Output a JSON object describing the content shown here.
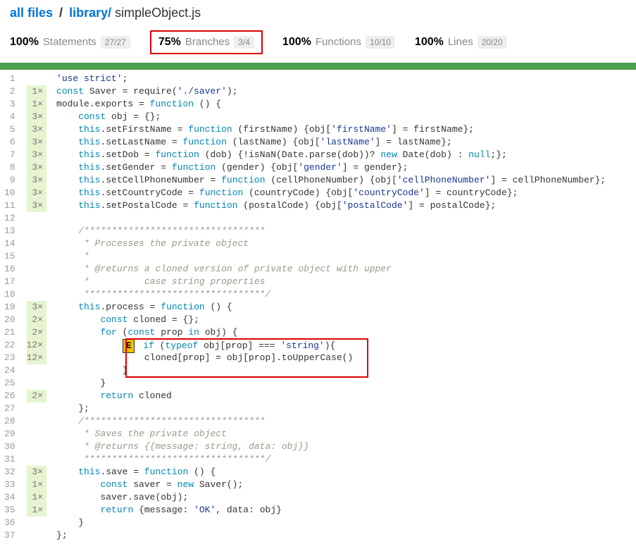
{
  "breadcrumb": {
    "root": "all files",
    "sep1": "/",
    "folder": "library/",
    "file": "simpleObject.js"
  },
  "stats": {
    "statements": {
      "pct": "100%",
      "label": "Statements",
      "fraction": "27/27"
    },
    "branches": {
      "pct": "75%",
      "label": "Branches",
      "fraction": "3/4"
    },
    "functions": {
      "pct": "100%",
      "label": "Functions",
      "fraction": "10/10"
    },
    "lines": {
      "pct": "100%",
      "label": "Lines",
      "fraction": "20/20"
    }
  },
  "lines": [
    {
      "num": 1,
      "hits": "",
      "tokens": [
        {
          "t": "str",
          "v": "'use strict'"
        },
        {
          "t": "",
          "v": ";"
        }
      ]
    },
    {
      "num": 2,
      "hits": "1×",
      "tokens": [
        {
          "t": "kw",
          "v": "const"
        },
        {
          "t": "",
          "v": " Saver = require("
        },
        {
          "t": "str",
          "v": "'./saver'"
        },
        {
          "t": "",
          "v": ");"
        }
      ]
    },
    {
      "num": 3,
      "hits": "1×",
      "tokens": [
        {
          "t": "",
          "v": "module.exports = "
        },
        {
          "t": "kw",
          "v": "function"
        },
        {
          "t": "",
          "v": " () {"
        }
      ]
    },
    {
      "num": 4,
      "hits": "3×",
      "tokens": [
        {
          "t": "",
          "v": "    "
        },
        {
          "t": "kw",
          "v": "const"
        },
        {
          "t": "",
          "v": " obj = {};"
        }
      ]
    },
    {
      "num": 5,
      "hits": "3×",
      "tokens": [
        {
          "t": "",
          "v": "    "
        },
        {
          "t": "kw",
          "v": "this"
        },
        {
          "t": "",
          "v": ".setFirstName = "
        },
        {
          "t": "kw",
          "v": "function"
        },
        {
          "t": "",
          "v": " (firstName) {obj["
        },
        {
          "t": "str",
          "v": "'firstName'"
        },
        {
          "t": "",
          "v": "] = firstName};"
        }
      ]
    },
    {
      "num": 6,
      "hits": "3×",
      "tokens": [
        {
          "t": "",
          "v": "    "
        },
        {
          "t": "kw",
          "v": "this"
        },
        {
          "t": "",
          "v": ".setLastName = "
        },
        {
          "t": "kw",
          "v": "function"
        },
        {
          "t": "",
          "v": " (lastName) {obj["
        },
        {
          "t": "str",
          "v": "'lastName'"
        },
        {
          "t": "",
          "v": "] = lastName};"
        }
      ]
    },
    {
      "num": 7,
      "hits": "3×",
      "tokens": [
        {
          "t": "",
          "v": "    "
        },
        {
          "t": "kw",
          "v": "this"
        },
        {
          "t": "",
          "v": ".setDob = "
        },
        {
          "t": "kw",
          "v": "function"
        },
        {
          "t": "",
          "v": " (dob) {!isNaN(Date.parse(dob))? "
        },
        {
          "t": "kw",
          "v": "new"
        },
        {
          "t": "",
          "v": " Date(dob) : "
        },
        {
          "t": "kw",
          "v": "null"
        },
        {
          "t": "",
          "v": ";};"
        }
      ]
    },
    {
      "num": 8,
      "hits": "3×",
      "tokens": [
        {
          "t": "",
          "v": "    "
        },
        {
          "t": "kw",
          "v": "this"
        },
        {
          "t": "",
          "v": ".setGender = "
        },
        {
          "t": "kw",
          "v": "function"
        },
        {
          "t": "",
          "v": " (gender) {obj["
        },
        {
          "t": "str",
          "v": "'gender'"
        },
        {
          "t": "",
          "v": "] = gender};"
        }
      ]
    },
    {
      "num": 9,
      "hits": "3×",
      "tokens": [
        {
          "t": "",
          "v": "    "
        },
        {
          "t": "kw",
          "v": "this"
        },
        {
          "t": "",
          "v": ".setCellPhoneNumber = "
        },
        {
          "t": "kw",
          "v": "function"
        },
        {
          "t": "",
          "v": " (cellPhoneNumber) {obj["
        },
        {
          "t": "str",
          "v": "'cellPhoneNumber'"
        },
        {
          "t": "",
          "v": "] = cellPhoneNumber};"
        }
      ]
    },
    {
      "num": 10,
      "hits": "3×",
      "tokens": [
        {
          "t": "",
          "v": "    "
        },
        {
          "t": "kw",
          "v": "this"
        },
        {
          "t": "",
          "v": ".setCountryCode = "
        },
        {
          "t": "kw",
          "v": "function"
        },
        {
          "t": "",
          "v": " (countryCode) {obj["
        },
        {
          "t": "str",
          "v": "'countryCode'"
        },
        {
          "t": "",
          "v": "] = countryCode};"
        }
      ]
    },
    {
      "num": 11,
      "hits": "3×",
      "tokens": [
        {
          "t": "",
          "v": "    "
        },
        {
          "t": "kw",
          "v": "this"
        },
        {
          "t": "",
          "v": ".setPostalCode = "
        },
        {
          "t": "kw",
          "v": "function"
        },
        {
          "t": "",
          "v": " (postalCode) {obj["
        },
        {
          "t": "str",
          "v": "'postalCode'"
        },
        {
          "t": "",
          "v": "] = postalCode};"
        }
      ]
    },
    {
      "num": 12,
      "hits": "",
      "tokens": [
        {
          "t": "",
          "v": " "
        }
      ]
    },
    {
      "num": 13,
      "hits": "",
      "tokens": [
        {
          "t": "",
          "v": "    "
        },
        {
          "t": "comment",
          "v": "/*********************************"
        }
      ]
    },
    {
      "num": 14,
      "hits": "",
      "tokens": [
        {
          "t": "",
          "v": "    "
        },
        {
          "t": "comment",
          "v": " * Processes the private object"
        }
      ]
    },
    {
      "num": 15,
      "hits": "",
      "tokens": [
        {
          "t": "",
          "v": "    "
        },
        {
          "t": "comment",
          "v": " *"
        }
      ]
    },
    {
      "num": 16,
      "hits": "",
      "tokens": [
        {
          "t": "",
          "v": "    "
        },
        {
          "t": "comment",
          "v": " * @returns a cloned version of private object with upper"
        }
      ]
    },
    {
      "num": 17,
      "hits": "",
      "tokens": [
        {
          "t": "",
          "v": "    "
        },
        {
          "t": "comment",
          "v": " *          case string properties"
        }
      ]
    },
    {
      "num": 18,
      "hits": "",
      "tokens": [
        {
          "t": "",
          "v": "    "
        },
        {
          "t": "comment",
          "v": " *********************************/"
        }
      ]
    },
    {
      "num": 19,
      "hits": "3×",
      "tokens": [
        {
          "t": "",
          "v": "    "
        },
        {
          "t": "kw",
          "v": "this"
        },
        {
          "t": "",
          "v": ".process = "
        },
        {
          "t": "kw",
          "v": "function"
        },
        {
          "t": "",
          "v": " () {"
        }
      ]
    },
    {
      "num": 20,
      "hits": "2×",
      "tokens": [
        {
          "t": "",
          "v": "        "
        },
        {
          "t": "kw",
          "v": "const"
        },
        {
          "t": "",
          "v": " cloned = {};"
        }
      ]
    },
    {
      "num": 21,
      "hits": "2×",
      "tokens": [
        {
          "t": "",
          "v": "        "
        },
        {
          "t": "kw",
          "v": "for"
        },
        {
          "t": "",
          "v": " ("
        },
        {
          "t": "kw",
          "v": "const"
        },
        {
          "t": "",
          "v": " prop "
        },
        {
          "t": "kw",
          "v": "in"
        },
        {
          "t": "",
          "v": " obj) {"
        }
      ]
    },
    {
      "num": 22,
      "hits": "12×",
      "tokens": [
        {
          "t": "",
          "v": "            "
        },
        {
          "t": "branch",
          "v": "E"
        },
        {
          "t": "",
          "v": " "
        },
        {
          "t": "kw",
          "v": "if"
        },
        {
          "t": "",
          "v": " ("
        },
        {
          "t": "kw",
          "v": "typeof"
        },
        {
          "t": "",
          "v": " obj[prop] === "
        },
        {
          "t": "str",
          "v": "'string'"
        },
        {
          "t": "",
          "v": "){"
        }
      ]
    },
    {
      "num": 23,
      "hits": "12×",
      "tokens": [
        {
          "t": "",
          "v": "                cloned[prop] = obj[prop].toUpperCase()"
        }
      ]
    },
    {
      "num": 24,
      "hits": "",
      "tokens": [
        {
          "t": "",
          "v": "            }"
        }
      ]
    },
    {
      "num": 25,
      "hits": "",
      "tokens": [
        {
          "t": "",
          "v": "        }"
        }
      ]
    },
    {
      "num": 26,
      "hits": "2×",
      "tokens": [
        {
          "t": "",
          "v": "        "
        },
        {
          "t": "kw",
          "v": "return"
        },
        {
          "t": "",
          "v": " cloned"
        }
      ]
    },
    {
      "num": 27,
      "hits": "",
      "tokens": [
        {
          "t": "",
          "v": "    };"
        }
      ]
    },
    {
      "num": 28,
      "hits": "",
      "tokens": [
        {
          "t": "",
          "v": "    "
        },
        {
          "t": "comment",
          "v": "/*********************************"
        }
      ]
    },
    {
      "num": 29,
      "hits": "",
      "tokens": [
        {
          "t": "",
          "v": "    "
        },
        {
          "t": "comment",
          "v": " * Saves the private object"
        }
      ]
    },
    {
      "num": 30,
      "hits": "",
      "tokens": [
        {
          "t": "",
          "v": "    "
        },
        {
          "t": "comment",
          "v": " * @returns {{message: string, data: obj}}"
        }
      ]
    },
    {
      "num": 31,
      "hits": "",
      "tokens": [
        {
          "t": "",
          "v": "    "
        },
        {
          "t": "comment",
          "v": " *********************************/"
        }
      ]
    },
    {
      "num": 32,
      "hits": "3×",
      "tokens": [
        {
          "t": "",
          "v": "    "
        },
        {
          "t": "kw",
          "v": "this"
        },
        {
          "t": "",
          "v": ".save = "
        },
        {
          "t": "kw",
          "v": "function"
        },
        {
          "t": "",
          "v": " () {"
        }
      ]
    },
    {
      "num": 33,
      "hits": "1×",
      "tokens": [
        {
          "t": "",
          "v": "        "
        },
        {
          "t": "kw",
          "v": "const"
        },
        {
          "t": "",
          "v": " saver = "
        },
        {
          "t": "kw",
          "v": "new"
        },
        {
          "t": "",
          "v": " Saver();"
        }
      ]
    },
    {
      "num": 34,
      "hits": "1×",
      "tokens": [
        {
          "t": "",
          "v": "        saver.save(obj);"
        }
      ]
    },
    {
      "num": 35,
      "hits": "1×",
      "tokens": [
        {
          "t": "",
          "v": "        "
        },
        {
          "t": "kw",
          "v": "return"
        },
        {
          "t": "",
          "v": " {message: "
        },
        {
          "t": "str",
          "v": "'OK'"
        },
        {
          "t": "",
          "v": ", data: obj}"
        }
      ]
    },
    {
      "num": 36,
      "hits": "",
      "tokens": [
        {
          "t": "",
          "v": "    }"
        }
      ]
    },
    {
      "num": 37,
      "hits": "",
      "tokens": [
        {
          "t": "",
          "v": "};"
        }
      ]
    }
  ]
}
